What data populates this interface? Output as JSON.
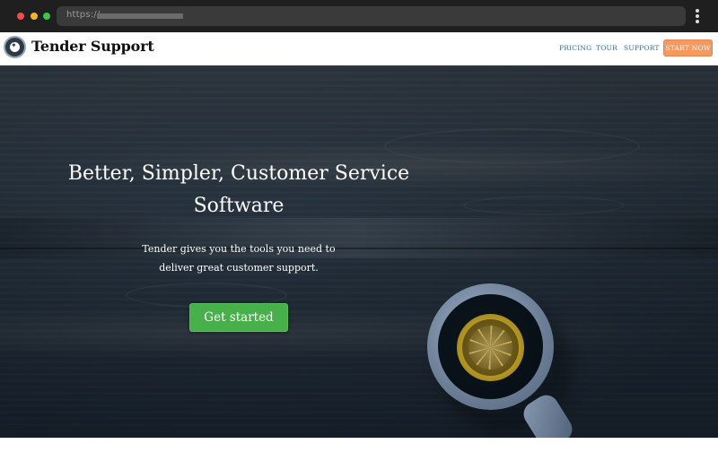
{
  "browser": {
    "url_prefix": "https://"
  },
  "navbar": {
    "brand": "Tender Support",
    "links": [
      {
        "label": "PRICING"
      },
      {
        "label": "TOUR"
      },
      {
        "label": "SUPPORT"
      }
    ],
    "cta_label": "START NOW"
  },
  "hero": {
    "title": "Better, Simpler, Customer Service Software",
    "subtitle": "Tender gives you the tools you need to deliver great customer support.",
    "button_label": "Get started"
  },
  "colors": {
    "browser_bg": "#1f1f1f",
    "nav_link": "#2a6f9d",
    "cta": "#f39a63",
    "primary_button": "#47b04b",
    "hero_bg": "#2e3944"
  },
  "icons": {
    "logo": "tender-logo-icon",
    "menu": "vertical-dots-icon"
  }
}
